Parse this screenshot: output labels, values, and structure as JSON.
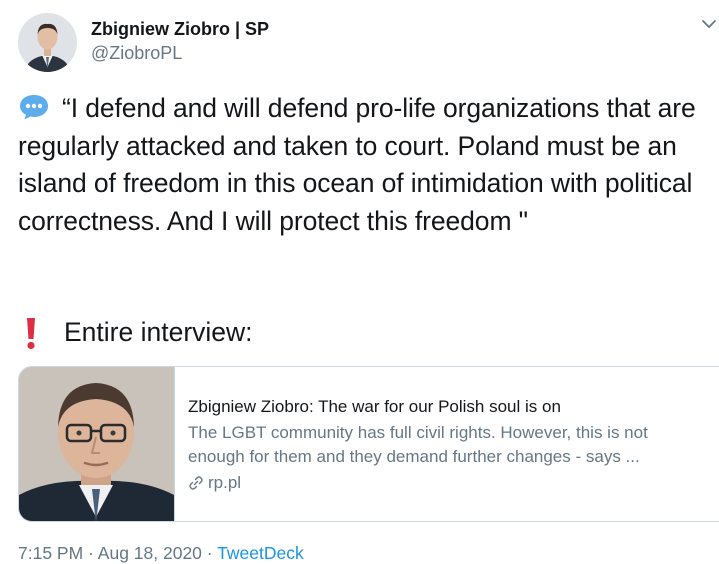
{
  "author": {
    "display_name": "Zbigniew Ziobro | SP",
    "handle": "@ZiobroPL"
  },
  "tweet": {
    "text": "“I defend and will defend pro-life organizations that are regularly attacked and taken to court. Poland must be an island of freedom in this ocean of intimidation with political correctness. And I will protect this freedom \"",
    "interview_label": "Entire interview:"
  },
  "card": {
    "title": "Zbigniew Ziobro: The war for our Polish soul is on",
    "description": "The LGBT community has full civil rights. However, this is not enough for them and they demand further changes - says ...",
    "domain": "rp.pl"
  },
  "meta": {
    "time": "7:15 PM",
    "separator": "·",
    "date": "Aug 18, 2020",
    "source": "TweetDeck"
  },
  "icons": {
    "speech": "speech-bubble-icon",
    "exclamation": "red-exclamation-icon",
    "link": "link-icon",
    "caret": "chevron-down-icon"
  },
  "colors": {
    "secondary_text": "#657786",
    "link_blue": "#1b95e0",
    "exclamation_red": "#dd2e44",
    "speech_blue": "#5dadec"
  }
}
